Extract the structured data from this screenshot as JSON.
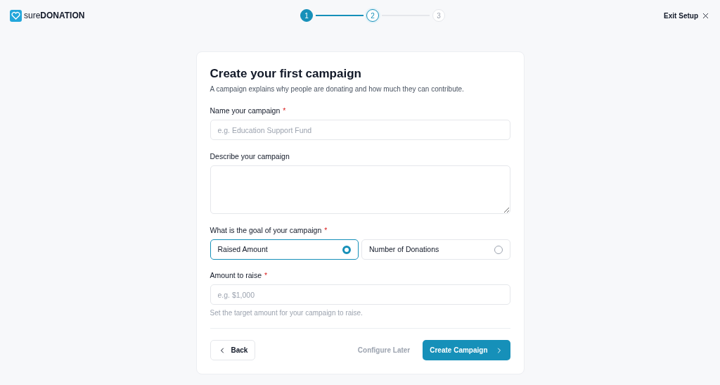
{
  "logo": {
    "text": "sure**DONATION**"
  },
  "steps": [
    {
      "label": "1",
      "completed": true,
      "selected": false
    },
    {
      "label": "2",
      "completed": false,
      "selected": true
    },
    {
      "label": "3",
      "completed": false,
      "selected": false
    }
  ],
  "exit": {
    "label": "Exit Setup"
  },
  "card": {
    "title": "Create your first campaign",
    "subtitle": "A campaign explains why people are donating and how much they can contribute.",
    "name_field": {
      "label": "Name your campaign",
      "mark": "*",
      "placeholder": "e.g. Education Support Fund"
    },
    "description_field": {
      "label": "Describe your campaign"
    },
    "goal": {
      "label": "What is the goal of your campaign",
      "mark": "*",
      "options": [
        {
          "label": "Raised Amount",
          "selected": true
        },
        {
          "label": "Number of Donations",
          "selected": false
        }
      ]
    },
    "amount_field": {
      "label": "Amount to raise",
      "mark": "*",
      "placeholder": "e.g. $1,000",
      "help": "Set the target amount for your campaign to raise."
    },
    "back": "Back",
    "later": "Configure Later",
    "create": "Create Campaign"
  }
}
